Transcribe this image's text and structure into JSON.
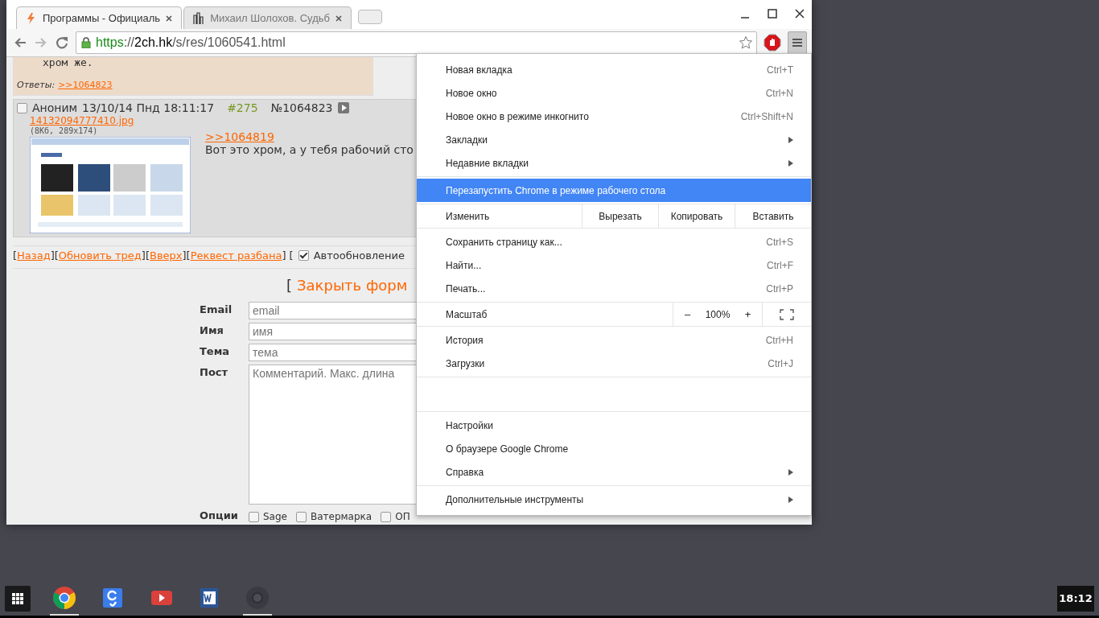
{
  "tabs": [
    {
      "title": "Программы - Официаль",
      "selected": true,
      "kind": "bolt"
    },
    {
      "title": "Михаил Шолохов. Судьб",
      "selected": false,
      "kind": "building"
    }
  ],
  "url": [
    {
      "text": "https",
      "kind": "scheme"
    },
    {
      "text": "://",
      "kind": "plain"
    },
    {
      "text": "2ch.hk",
      "kind": "host"
    },
    {
      "text": "/s/res/1060541.html",
      "kind": "plain"
    }
  ],
  "prev_post": {
    "text": "хром же.",
    "replies_label": "Ответы:",
    "reply_link": ">>1064823"
  },
  "post": {
    "checked": false,
    "name": "Аноним",
    "date": "13/10/14 Пнд 18:11:17",
    "number": "#275",
    "id": "№1064823",
    "file_link": "14132094777410.jpg",
    "file_info": "(8Кб, 289x174)",
    "reply_link": ">>1064819",
    "text": "Вот это хром, а у тебя рабочий сто"
  },
  "nav": {
    "open": "[",
    "separator": "][",
    "close": "]",
    "links": [
      "Назад",
      "Обновить тред",
      "Вверх",
      "Реквест разбана"
    ],
    "after": "[",
    "autoupdate": {
      "checked": true,
      "label": "Автообновление"
    }
  },
  "close_form": {
    "bracket": "[",
    "label": "Закрыть форм"
  },
  "form": {
    "fields": [
      {
        "label": "Email",
        "placeholder": "email",
        "kind": "input"
      },
      {
        "label": "Имя",
        "placeholder": "имя",
        "kind": "input"
      },
      {
        "label": "Тема",
        "placeholder": "тема",
        "kind": "input"
      },
      {
        "label": "Пост",
        "placeholder": "Комментарий. Макс. длина",
        "kind": "textarea"
      }
    ],
    "options_label": "Опции",
    "options": [
      {
        "label": "Sage",
        "checked": false
      },
      {
        "label": "Ватермарка",
        "checked": false
      },
      {
        "label": "ОП",
        "checked": false
      }
    ]
  },
  "menu": [
    [
      {
        "kind": "item",
        "label": "Новая вкладка",
        "shortcut": "Ctrl+T"
      },
      {
        "kind": "item",
        "label": "Новое окно",
        "shortcut": "Ctrl+N"
      },
      {
        "kind": "item",
        "label": "Новое окно в режиме инкогнито",
        "shortcut": "Ctrl+Shift+N"
      },
      {
        "kind": "item",
        "label": "Закладки",
        "submenu": true
      },
      {
        "kind": "item",
        "label": "Недавние вкладки",
        "submenu": true
      }
    ],
    [
      {
        "kind": "item",
        "label": "Перезапустить Chrome в режиме рабочего стола",
        "selected": true
      }
    ],
    [
      {
        "kind": "edit",
        "label": "Изменить",
        "buttons": [
          "Вырезать",
          "Копировать",
          "Вставить"
        ]
      }
    ],
    [
      {
        "kind": "item",
        "label": "Сохранить страницу как...",
        "shortcut": "Ctrl+S"
      },
      {
        "kind": "item",
        "label": "Найти...",
        "shortcut": "Ctrl+F"
      },
      {
        "kind": "item",
        "label": "Печать...",
        "shortcut": "Ctrl+P"
      }
    ],
    [
      {
        "kind": "zoom",
        "label": "Масштаб",
        "minus": "–",
        "value": "100%",
        "plus": "+"
      }
    ],
    [
      {
        "kind": "item",
        "label": "История",
        "shortcut": "Ctrl+H"
      },
      {
        "kind": "item",
        "label": "Загрузки",
        "shortcut": "Ctrl+J"
      }
    ],
    [
      {
        "kind": "blank"
      }
    ],
    [
      {
        "kind": "item",
        "label": "Настройки"
      },
      {
        "kind": "item",
        "label": "О браузере Google Chrome"
      },
      {
        "kind": "item",
        "label": "Справка",
        "submenu": true
      }
    ],
    [
      {
        "kind": "item",
        "label": "Дополнительные инструменты",
        "submenu": true
      }
    ]
  ],
  "taskbar": {
    "apps": [
      {
        "kind": "chrome",
        "running": true
      },
      {
        "kind": "g",
        "running": false
      },
      {
        "kind": "play",
        "running": false
      },
      {
        "kind": "doc",
        "running": false
      },
      {
        "kind": "chromedim",
        "running": true
      }
    ],
    "clock": "18:12"
  }
}
